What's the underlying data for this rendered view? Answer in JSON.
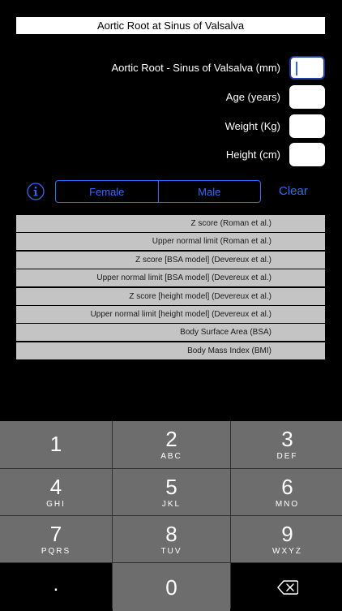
{
  "title": "Aortic Root at Sinus of Valsalva",
  "fields": [
    {
      "label": "Aortic Root - Sinus of Valsalva (mm)",
      "value": ""
    },
    {
      "label": "Age (years)",
      "value": ""
    },
    {
      "label": "Weight (Kg)",
      "value": ""
    },
    {
      "label": "Height (cm)",
      "value": ""
    }
  ],
  "info_icon": "info-circle-icon",
  "gender": {
    "options": [
      "Female",
      "Male"
    ]
  },
  "clear_label": "Clear",
  "results": [
    "Z score (Roman et al.)",
    "Upper normal limit (Roman et al.)",
    "Z score [BSA model] (Devereux et al.)",
    "Upper normal limit [BSA model] (Devereux et al.)",
    "Z score [height model] (Devereux et al.)",
    "Upper normal limit [height model] (Devereux et al.)",
    "Body Surface Area (BSA)",
    "Body Mass Index (BMI)"
  ],
  "keypad": {
    "k1": {
      "num": "1",
      "letters": ""
    },
    "k2": {
      "num": "2",
      "letters": "ABC"
    },
    "k3": {
      "num": "3",
      "letters": "DEF"
    },
    "k4": {
      "num": "4",
      "letters": "GHI"
    },
    "k5": {
      "num": "5",
      "letters": "JKL"
    },
    "k6": {
      "num": "6",
      "letters": "MNO"
    },
    "k7": {
      "num": "7",
      "letters": "PQRS"
    },
    "k8": {
      "num": "8",
      "letters": "TUV"
    },
    "k9": {
      "num": "9",
      "letters": "WXYZ"
    },
    "dot": ".",
    "k0": {
      "num": "0"
    },
    "delete_icon": "backspace-icon"
  },
  "colors": {
    "accent": "#2f6bff",
    "result_bg": "#c4c4c4",
    "key_bg": "#6d6d6d"
  }
}
